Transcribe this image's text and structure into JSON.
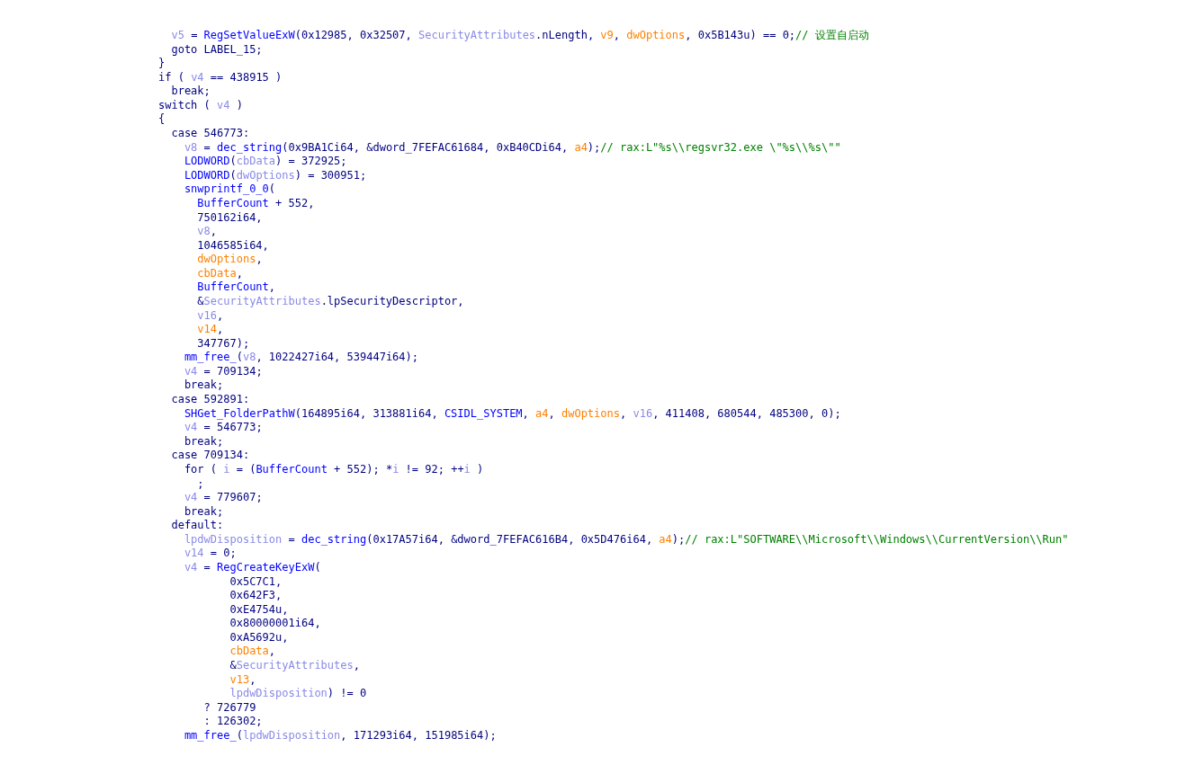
{
  "code_view": {
    "lines": [
      {
        "tokens": [
          {
            "text": "  v5",
            "kind": "local"
          },
          {
            "text": " = ",
            "kind": "plain"
          },
          {
            "text": "RegSetValueExW",
            "kind": "func"
          },
          {
            "text": "(0x12985, 0x32507, ",
            "kind": "plain"
          },
          {
            "text": "SecurityAttributes",
            "kind": "local"
          },
          {
            "text": ".nLength, ",
            "kind": "plain"
          },
          {
            "text": "v9",
            "kind": "arg"
          },
          {
            "text": ", ",
            "kind": "plain"
          },
          {
            "text": "dwOptions",
            "kind": "arg"
          },
          {
            "text": ", 0x5B143u) == 0;",
            "kind": "plain"
          },
          {
            "text": "// 设置自启动",
            "kind": "comment"
          }
        ]
      },
      {
        "tokens": [
          {
            "text": "  goto LABEL_15;",
            "kind": "plain"
          }
        ]
      },
      {
        "tokens": [
          {
            "text": "}",
            "kind": "plain"
          }
        ]
      },
      {
        "tokens": [
          {
            "text": "if ( ",
            "kind": "plain"
          },
          {
            "text": "v4",
            "kind": "local"
          },
          {
            "text": " == 438915 )",
            "kind": "plain"
          }
        ]
      },
      {
        "tokens": [
          {
            "text": "  break;",
            "kind": "plain"
          }
        ]
      },
      {
        "tokens": [
          {
            "text": "switch ( ",
            "kind": "plain"
          },
          {
            "text": "v4",
            "kind": "local"
          },
          {
            "text": " )",
            "kind": "plain"
          }
        ]
      },
      {
        "tokens": [
          {
            "text": "{",
            "kind": "plain"
          }
        ]
      },
      {
        "tokens": [
          {
            "text": "  case 546773:",
            "kind": "plain"
          }
        ]
      },
      {
        "tokens": [
          {
            "text": "    v8",
            "kind": "local"
          },
          {
            "text": " = ",
            "kind": "plain"
          },
          {
            "text": "dec_string",
            "kind": "func"
          },
          {
            "text": "(0x9BA1Ci64, &dword_7FEFAC61684, 0xB40CDi64, ",
            "kind": "plain"
          },
          {
            "text": "a4",
            "kind": "arg"
          },
          {
            "text": ");",
            "kind": "plain"
          },
          {
            "text": "// rax:L\"%s\\\\regsvr32.exe \\\"%s\\\\%s\\\"\"",
            "kind": "comment"
          }
        ]
      },
      {
        "tokens": [
          {
            "text": "    LODWORD",
            "kind": "func"
          },
          {
            "text": "(",
            "kind": "plain"
          },
          {
            "text": "cbData",
            "kind": "local"
          },
          {
            "text": ") = 372925;",
            "kind": "plain"
          }
        ]
      },
      {
        "tokens": [
          {
            "text": "    LODWORD",
            "kind": "func"
          },
          {
            "text": "(",
            "kind": "plain"
          },
          {
            "text": "dwOptions",
            "kind": "local"
          },
          {
            "text": ") = 300951;",
            "kind": "plain"
          }
        ]
      },
      {
        "tokens": [
          {
            "text": "    snwprintf_0_0",
            "kind": "func"
          },
          {
            "text": "(",
            "kind": "plain"
          }
        ]
      },
      {
        "tokens": [
          {
            "text": "      BufferCount",
            "kind": "func"
          },
          {
            "text": " + 552,",
            "kind": "plain"
          }
        ]
      },
      {
        "tokens": [
          {
            "text": "      750162i64,",
            "kind": "plain"
          }
        ]
      },
      {
        "tokens": [
          {
            "text": "      v8",
            "kind": "local"
          },
          {
            "text": ",",
            "kind": "plain"
          }
        ]
      },
      {
        "tokens": [
          {
            "text": "      1046585i64,",
            "kind": "plain"
          }
        ]
      },
      {
        "tokens": [
          {
            "text": "      dwOptions",
            "kind": "arg"
          },
          {
            "text": ",",
            "kind": "plain"
          }
        ]
      },
      {
        "tokens": [
          {
            "text": "      cbData",
            "kind": "arg"
          },
          {
            "text": ",",
            "kind": "plain"
          }
        ]
      },
      {
        "tokens": [
          {
            "text": "      BufferCount",
            "kind": "func"
          },
          {
            "text": ",",
            "kind": "plain"
          }
        ]
      },
      {
        "tokens": [
          {
            "text": "      &",
            "kind": "plain"
          },
          {
            "text": "SecurityAttributes",
            "kind": "local"
          },
          {
            "text": ".lpSecurityDescriptor,",
            "kind": "plain"
          }
        ]
      },
      {
        "tokens": [
          {
            "text": "      v16",
            "kind": "local"
          },
          {
            "text": ",",
            "kind": "plain"
          }
        ]
      },
      {
        "tokens": [
          {
            "text": "      v14",
            "kind": "arg"
          },
          {
            "text": ",",
            "kind": "plain"
          }
        ]
      },
      {
        "tokens": [
          {
            "text": "      347767);",
            "kind": "plain"
          }
        ]
      },
      {
        "tokens": [
          {
            "text": "    mm_free_",
            "kind": "func"
          },
          {
            "text": "(",
            "kind": "plain"
          },
          {
            "text": "v8",
            "kind": "local"
          },
          {
            "text": ", 1022427i64, 539447i64);",
            "kind": "plain"
          }
        ]
      },
      {
        "tokens": [
          {
            "text": "    v4",
            "kind": "local"
          },
          {
            "text": " = 709134;",
            "kind": "plain"
          }
        ]
      },
      {
        "tokens": [
          {
            "text": "    break;",
            "kind": "plain"
          }
        ]
      },
      {
        "tokens": [
          {
            "text": "  case 592891:",
            "kind": "plain"
          }
        ]
      },
      {
        "tokens": [
          {
            "text": "    SHGet_FolderPathW",
            "kind": "func"
          },
          {
            "text": "(164895i64, 313881i64, ",
            "kind": "plain"
          },
          {
            "text": "CSIDL_SYSTEM",
            "kind": "func"
          },
          {
            "text": ", ",
            "kind": "plain"
          },
          {
            "text": "a4",
            "kind": "arg"
          },
          {
            "text": ", ",
            "kind": "plain"
          },
          {
            "text": "dwOptions",
            "kind": "arg"
          },
          {
            "text": ", ",
            "kind": "plain"
          },
          {
            "text": "v16",
            "kind": "local"
          },
          {
            "text": ", 411408, 680544, 485300, 0);",
            "kind": "plain"
          }
        ]
      },
      {
        "tokens": [
          {
            "text": "    v4",
            "kind": "local"
          },
          {
            "text": " = 546773;",
            "kind": "plain"
          }
        ]
      },
      {
        "tokens": [
          {
            "text": "    break;",
            "kind": "plain"
          }
        ]
      },
      {
        "tokens": [
          {
            "text": "  case 709134:",
            "kind": "plain"
          }
        ]
      },
      {
        "tokens": [
          {
            "text": "    for ( ",
            "kind": "plain"
          },
          {
            "text": "i",
            "kind": "local"
          },
          {
            "text": " = (",
            "kind": "plain"
          },
          {
            "text": "BufferCount",
            "kind": "func"
          },
          {
            "text": " + 552); *",
            "kind": "plain"
          },
          {
            "text": "i",
            "kind": "local"
          },
          {
            "text": " != 92; ++",
            "kind": "plain"
          },
          {
            "text": "i",
            "kind": "local"
          },
          {
            "text": " )",
            "kind": "plain"
          }
        ]
      },
      {
        "tokens": [
          {
            "text": "      ;",
            "kind": "plain"
          }
        ]
      },
      {
        "tokens": [
          {
            "text": "    v4",
            "kind": "local"
          },
          {
            "text": " = 779607;",
            "kind": "plain"
          }
        ]
      },
      {
        "tokens": [
          {
            "text": "    break;",
            "kind": "plain"
          }
        ]
      },
      {
        "tokens": [
          {
            "text": "  default:",
            "kind": "plain"
          }
        ]
      },
      {
        "tokens": [
          {
            "text": "    lpdwDisposition",
            "kind": "local"
          },
          {
            "text": " = ",
            "kind": "plain"
          },
          {
            "text": "dec_string",
            "kind": "func"
          },
          {
            "text": "(0x17A57i64, &dword_7FEFAC616B4, 0x5D476i64, ",
            "kind": "plain"
          },
          {
            "text": "a4",
            "kind": "arg"
          },
          {
            "text": ");",
            "kind": "plain"
          },
          {
            "text": "// rax:L\"SOFTWARE\\\\Microsoft\\\\Windows\\\\CurrentVersion\\\\Run\"",
            "kind": "comment"
          }
        ]
      },
      {
        "tokens": [
          {
            "text": "    v14",
            "kind": "local"
          },
          {
            "text": " = 0;",
            "kind": "plain"
          }
        ]
      },
      {
        "tokens": [
          {
            "text": "    v4",
            "kind": "local"
          },
          {
            "text": " = ",
            "kind": "plain"
          },
          {
            "text": "RegCreateKeyExW",
            "kind": "func"
          },
          {
            "text": "(",
            "kind": "plain"
          }
        ]
      },
      {
        "tokens": [
          {
            "text": "           0x5C7C1,",
            "kind": "plain"
          }
        ]
      },
      {
        "tokens": [
          {
            "text": "           0x642F3,",
            "kind": "plain"
          }
        ]
      },
      {
        "tokens": [
          {
            "text": "           0xE4754u,",
            "kind": "plain"
          }
        ]
      },
      {
        "tokens": [
          {
            "text": "           0x80000001i64,",
            "kind": "plain"
          }
        ]
      },
      {
        "tokens": [
          {
            "text": "           0xA5692u,",
            "kind": "plain"
          }
        ]
      },
      {
        "tokens": [
          {
            "text": "           cbData",
            "kind": "arg"
          },
          {
            "text": ",",
            "kind": "plain"
          }
        ]
      },
      {
        "tokens": [
          {
            "text": "           &",
            "kind": "plain"
          },
          {
            "text": "SecurityAttributes",
            "kind": "local"
          },
          {
            "text": ",",
            "kind": "plain"
          }
        ]
      },
      {
        "tokens": [
          {
            "text": "           v13",
            "kind": "arg"
          },
          {
            "text": ",",
            "kind": "plain"
          }
        ]
      },
      {
        "tokens": [
          {
            "text": "           lpdwDisposition",
            "kind": "local"
          },
          {
            "text": ") != 0",
            "kind": "plain"
          }
        ]
      },
      {
        "tokens": [
          {
            "text": "       ? 726779",
            "kind": "plain"
          }
        ]
      },
      {
        "tokens": [
          {
            "text": "       : 126302;",
            "kind": "plain"
          }
        ]
      },
      {
        "tokens": [
          {
            "text": "    mm_free_",
            "kind": "func"
          },
          {
            "text": "(",
            "kind": "plain"
          },
          {
            "text": "lpdwDisposition",
            "kind": "local"
          },
          {
            "text": ", 171293i64, 151985i64);",
            "kind": "plain"
          }
        ]
      }
    ]
  }
}
